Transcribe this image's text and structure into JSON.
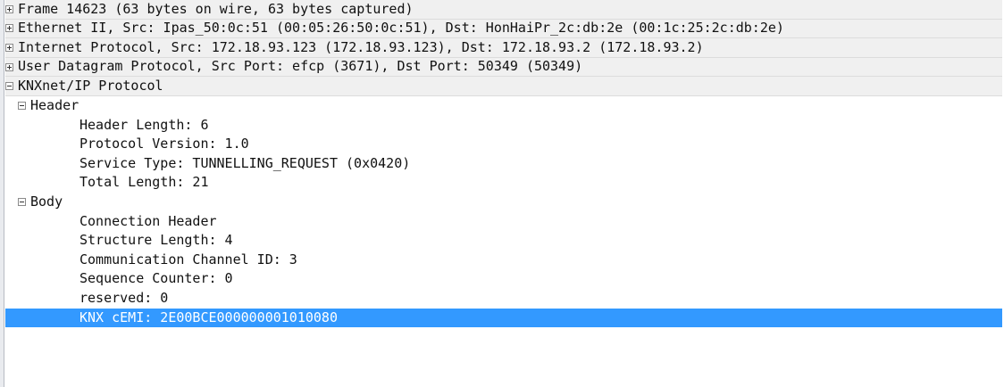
{
  "tree": {
    "frame": "Frame 14623 (63 bytes on wire, 63 bytes captured)",
    "ethernet": "Ethernet II, Src: Ipas_50:0c:51 (00:05:26:50:0c:51), Dst: HonHaiPr_2c:db:2e (00:1c:25:2c:db:2e)",
    "ip": "Internet Protocol, Src: 172.18.93.123 (172.18.93.123), Dst: 172.18.93.2 (172.18.93.2)",
    "udp": "User Datagram Protocol, Src Port: efcp (3671), Dst Port: 50349 (50349)",
    "knxnet": "KNXnet/IP Protocol",
    "header": {
      "label": "Header",
      "fields": [
        "Header Length: 6",
        "Protocol Version: 1.0",
        "Service Type: TUNNELLING_REQUEST (0x0420)",
        "Total Length: 21"
      ]
    },
    "body": {
      "label": "Body",
      "fields": [
        "Connection Header",
        "Structure Length: 4",
        "Communication Channel ID: 3",
        "Sequence Counter: 0",
        "reserved: 0"
      ],
      "selected": "KNX cEMI: 2E00BCE000000001010080"
    }
  }
}
